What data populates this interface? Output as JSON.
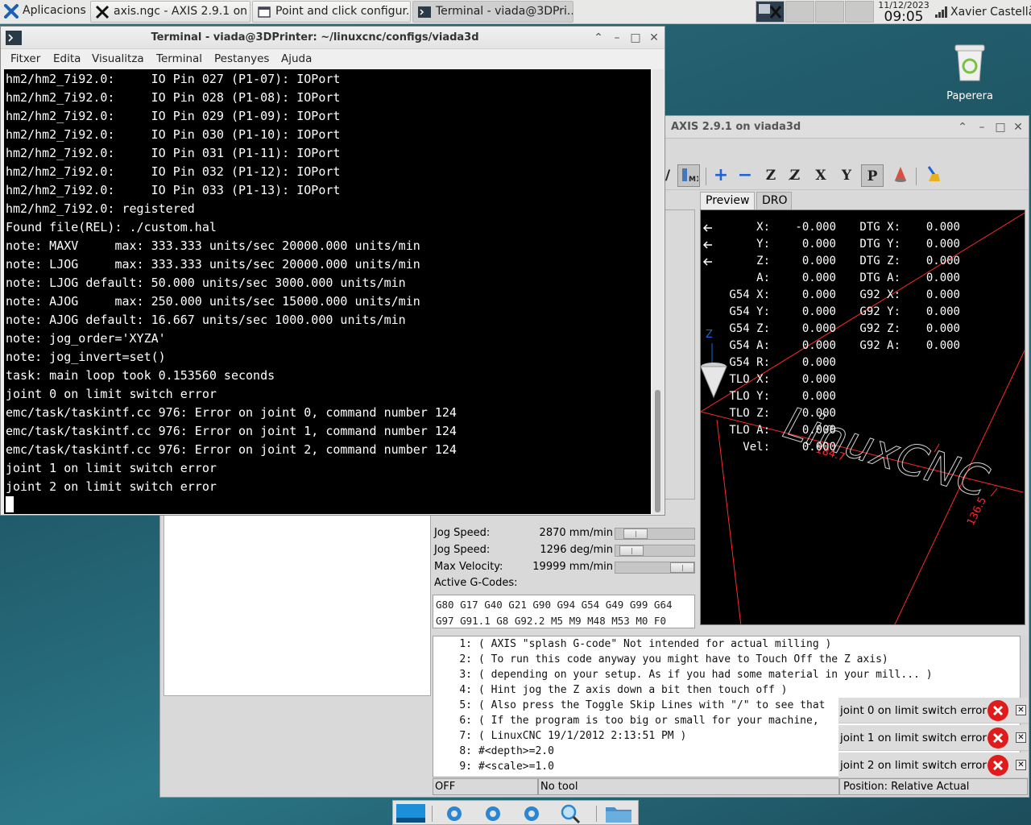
{
  "top_panel": {
    "apps_label": "Aplicacions",
    "tasks": [
      {
        "label": "axis.ngc - AXIS 2.9.1 on ..."
      },
      {
        "label": "Point and click configur..."
      },
      {
        "label": "Terminal - viada@3DPri..."
      }
    ],
    "clock_date": "11/12/2023",
    "clock_time": "09:05",
    "user_name": "Xavier Castellà"
  },
  "desktop": {
    "trash_label": "Paperera"
  },
  "terminal": {
    "title": "Terminal - viada@3DPrinter: ~/linuxcnc/configs/viada3d",
    "menu": [
      "Fitxer",
      "Edita",
      "Visualitza",
      "Terminal",
      "Pestanyes",
      "Ajuda"
    ],
    "lines": [
      "hm2/hm2_7i92.0:     IO Pin 027 (P1-07): IOPort",
      "hm2/hm2_7i92.0:     IO Pin 028 (P1-08): IOPort",
      "hm2/hm2_7i92.0:     IO Pin 029 (P1-09): IOPort",
      "hm2/hm2_7i92.0:     IO Pin 030 (P1-10): IOPort",
      "hm2/hm2_7i92.0:     IO Pin 031 (P1-11): IOPort",
      "hm2/hm2_7i92.0:     IO Pin 032 (P1-12): IOPort",
      "hm2/hm2_7i92.0:     IO Pin 033 (P1-13): IOPort",
      "hm2/hm2_7i92.0: registered",
      "Found file(REL): ./custom.hal",
      "note: MAXV     max: 333.333 units/sec 20000.000 units/min",
      "note: LJOG     max: 333.333 units/sec 20000.000 units/min",
      "note: LJOG default: 50.000 units/sec 3000.000 units/min",
      "note: AJOG     max: 250.000 units/sec 15000.000 units/min",
      "note: AJOG default: 16.667 units/sec 1000.000 units/min",
      "note: jog_order='XYZA'",
      "note: jog_invert=set()",
      "task: main loop took 0.153560 seconds",
      "joint 0 on limit switch error",
      "emc/task/taskintf.cc 976: Error on joint 0, command number 124",
      "emc/task/taskintf.cc 976: Error on joint 1, command number 124",
      "emc/task/taskintf.cc 976: Error on joint 2, command number 124",
      "joint 1 on limit switch error",
      "joint 2 on limit switch error"
    ]
  },
  "axis": {
    "title": "AXIS 2.9.1 on viada3d",
    "tabs": [
      "Preview",
      "DRO"
    ],
    "sliders": [
      {
        "label": "Jog Speed:",
        "value": "2870 mm/min",
        "fraction": 0.14
      },
      {
        "label": "Jog Speed:",
        "value": "1296 deg/min",
        "fraction": 0.08
      },
      {
        "label": "Max Velocity:",
        "value": "19999 mm/min",
        "fraction": 1.0
      }
    ],
    "active_gcodes_label": "Active G-Codes:",
    "active_gcodes": [
      "G80 G17 G40 G21 G90 G94 G54 G49 G99 G64",
      "G97 G91.1 G8 G92.2 M5 M9 M48 M53 M0 F0"
    ],
    "dro_left": [
      {
        "label": "X:",
        "value": "-0.000"
      },
      {
        "label": "Y:",
        "value": "0.000"
      },
      {
        "label": "Z:",
        "value": "0.000"
      },
      {
        "label": "A:",
        "value": "0.000"
      },
      {
        "label": "G54 X:",
        "value": "0.000"
      },
      {
        "label": "G54 Y:",
        "value": "0.000"
      },
      {
        "label": "G54 Z:",
        "value": "0.000"
      },
      {
        "label": "G54 A:",
        "value": "0.000"
      },
      {
        "label": "G54 R:",
        "value": "0.000"
      },
      {
        "label": "TLO X:",
        "value": "0.000"
      },
      {
        "label": "TLO Y:",
        "value": "0.000"
      },
      {
        "label": "TLO Z:",
        "value": "0.000"
      },
      {
        "label": "TLO A:",
        "value": "0.000"
      },
      {
        "label": "Vel:",
        "value": "0.000"
      }
    ],
    "dro_right": [
      {
        "label": "DTG X:",
        "value": "0.000"
      },
      {
        "label": "DTG Y:",
        "value": "0.000"
      },
      {
        "label": "DTG Z:",
        "value": "0.000"
      },
      {
        "label": "DTG A:",
        "value": "0.000"
      },
      {
        "label": "G92 X:",
        "value": "0.000"
      },
      {
        "label": "G92 Y:",
        "value": "0.000"
      },
      {
        "label": "G92 Z:",
        "value": "0.000"
      },
      {
        "label": "G92 A:",
        "value": "0.000"
      }
    ],
    "preview_text": {
      "logo": "LinuxCNC",
      "dim1": "184.7",
      "dim2": "136.5",
      "axis_z": "Z"
    },
    "gcode_lines": [
      {
        "n": "1:",
        "text": "( AXIS \"splash G-code\" Not intended for actual milling )"
      },
      {
        "n": "2:",
        "text": "( To run this code anyway you might have to Touch Off the Z axis)"
      },
      {
        "n": "3:",
        "text": "( depending on your setup. As if you had some material in your mill... )"
      },
      {
        "n": "4:",
        "text": "( Hint jog the Z axis down a bit then touch off )"
      },
      {
        "n": "5:",
        "text": "( Also press the Toggle Skip Lines with \"/\" to see that"
      },
      {
        "n": "6:",
        "text": "( If the program is too big or small for your machine,"
      },
      {
        "n": "7:",
        "text": "( LinuxCNC 19/1/2012 2:13:51 PM )"
      },
      {
        "n": "8:",
        "text": "#<depth>=2.0"
      },
      {
        "n": "9:",
        "text": "#<scale>=1.0"
      }
    ],
    "status": {
      "state": "OFF",
      "tool": "No tool",
      "position": "Position: Relative Actual"
    },
    "notifications": [
      "joint 0 on limit switch error",
      "joint 1 on limit switch error",
      "joint 2 on limit switch error"
    ]
  },
  "colors": {
    "terminal_bg": "#000000",
    "terminal_fg": "#ffffff",
    "preview_grid": "#ff2a2a",
    "toolbar_blue": "#1d63d8",
    "error_red": "#e01b1b"
  }
}
